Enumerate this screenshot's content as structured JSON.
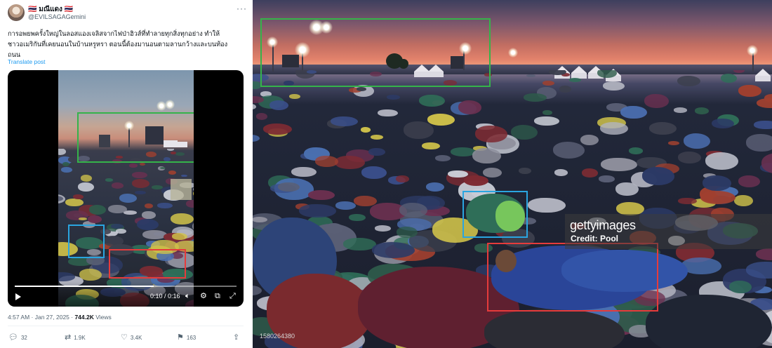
{
  "tweet": {
    "display_name": "🇹🇭 มณีแดง 🇹🇭",
    "handle": "@EVILSAGAGemini",
    "more_label": "···",
    "text_line_1": "การอพยพครั้งใหญ่ในลอสแองเจลิสจากไฟป่าฮิวส์ที่ทำลายทุกสิ่งทุกอย่าง ทำให้",
    "text_line_2": "ชาวอเมริกันที่เคยนอนในบ้านหรูหรา ตอนนี้ต้องมานอนตามลานกว้างและบนท้อง",
    "text_line_3": "ถนน",
    "translate_label": "Translate post",
    "video": {
      "time": "0:10 / 0:16",
      "progress": 0.625
    },
    "timestamp": "4:57 AM · Jan 27, 2025 · ",
    "views_count": "744.2K",
    "views_label": " Views",
    "actions": {
      "replies": "32",
      "reposts": "1.9K",
      "likes": "3.4K",
      "bookmarks": "163"
    }
  },
  "photo": {
    "watermark": "gettyimages",
    "credit": "Credit: Pool",
    "image_id": "1580264380"
  },
  "colors": {
    "box_green": "#35b34a",
    "box_blue": "#2aa5e0",
    "box_red": "#e63b3b",
    "link": "#1d9bf0"
  },
  "icons": [
    "play-icon",
    "volume-icon",
    "settings-icon",
    "dock-icon",
    "fullscreen-icon",
    "reply-icon",
    "repost-icon",
    "like-icon",
    "bookmark-icon",
    "share-icon"
  ]
}
